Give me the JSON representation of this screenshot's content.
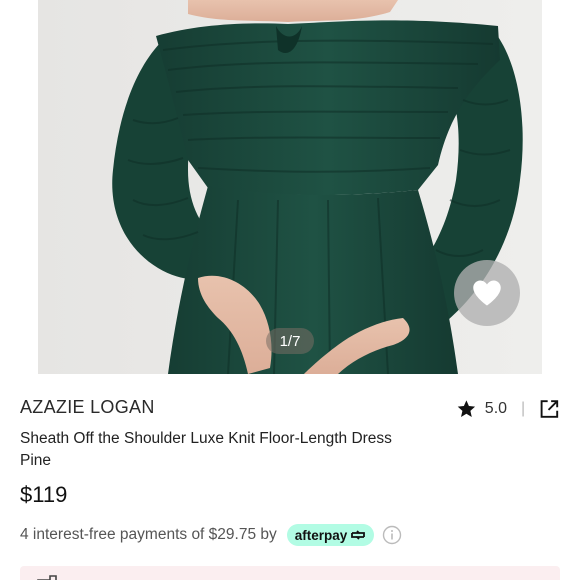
{
  "product": {
    "brand": "AZAZIE LOGAN",
    "title_line1": "Sheath Off the Shoulder Luxe Knit Floor-Length Dress",
    "title_line2": "Pine",
    "price": "$119",
    "rating": "5.0",
    "rating_separator": "|",
    "image_counter": "1/7",
    "color_hex": "#1d4a3e"
  },
  "payment": {
    "installment_text": "4 interest-free payments of $29.75 by",
    "provider": "afterpay",
    "provider_color": "#b2fce4"
  },
  "icons": {
    "wishlist": "heart-icon",
    "rating": "star-icon",
    "share": "share-external-icon",
    "info": "info-icon"
  }
}
